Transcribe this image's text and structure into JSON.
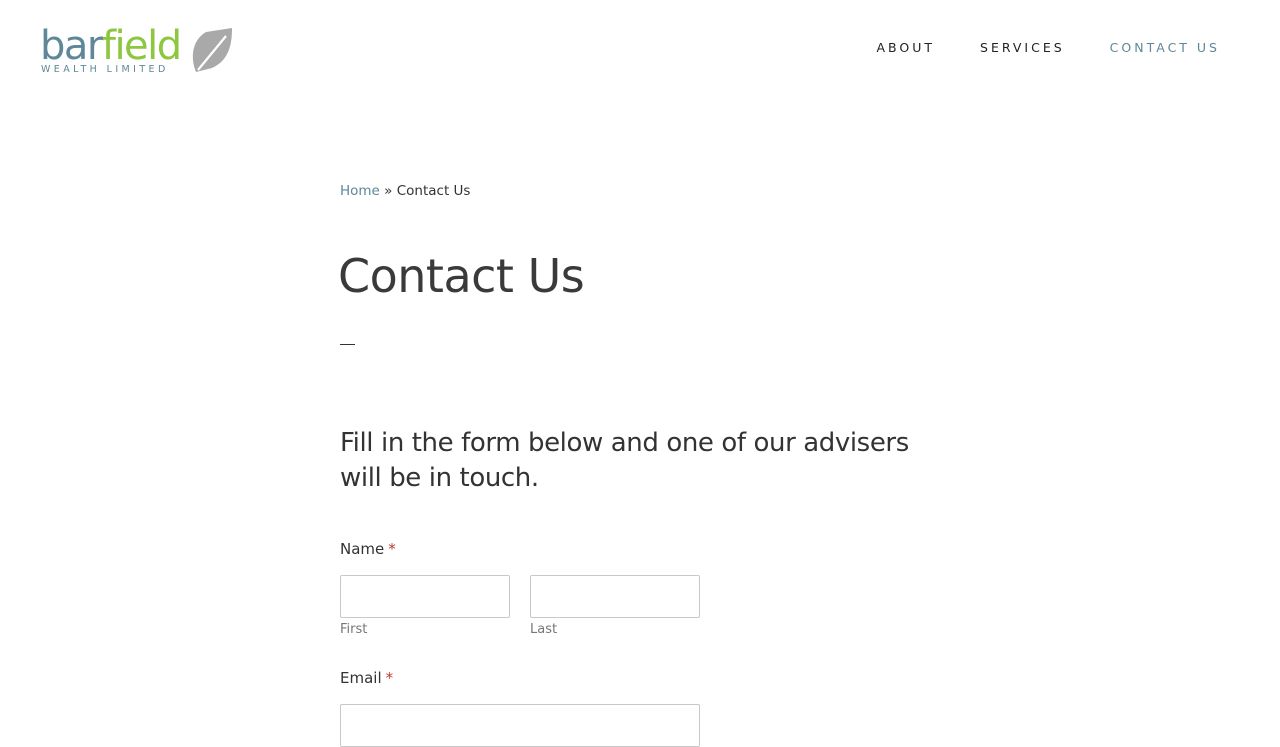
{
  "logo": {
    "word_part1": "bar",
    "word_part2": "field",
    "tagline": "WEALTH LIMITED",
    "icon": "leaf-icon",
    "colors": {
      "primary": "#5e8797",
      "accent": "#8dc63f",
      "leaf": "#a9a9a9"
    }
  },
  "nav": {
    "items": [
      {
        "label": "ABOUT"
      },
      {
        "label": "SERVICES"
      },
      {
        "label": "CONTACT US",
        "active": true
      }
    ]
  },
  "breadcrumb": {
    "home": "Home",
    "separator": "»",
    "current": "Contact Us"
  },
  "page": {
    "title": "Contact Us",
    "intro": "Fill in the form below and one of our advisers will be in touch."
  },
  "form": {
    "name": {
      "label": "Name",
      "required_marker": "*",
      "first_value": "",
      "first_sublabel": "First",
      "last_value": "",
      "last_sublabel": "Last"
    },
    "email": {
      "label": "Email",
      "required_marker": "*",
      "value": ""
    }
  }
}
